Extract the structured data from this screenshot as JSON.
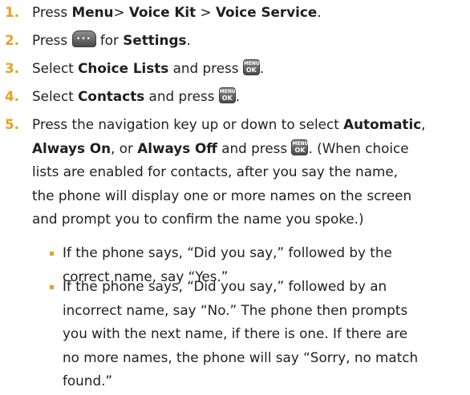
{
  "ok_icon": {
    "top": "MENU",
    "bottom": "OK"
  },
  "steps": [
    {
      "number": "1.",
      "a": "Press ",
      "b1": "Menu",
      "c": "> ",
      "b2": "Voice Kit",
      "d": " > ",
      "b3": "Voice Service",
      "e": "."
    },
    {
      "number": "2.",
      "a": "Press ",
      "b": " for ",
      "bold": "Settings",
      "c": "."
    },
    {
      "number": "3.",
      "a": "Select ",
      "bold": "Choice Lists",
      "b": " and press ",
      "c": "."
    },
    {
      "number": "4.",
      "a": "Select ",
      "bold": "Contacts",
      "b": " and press ",
      "c": "."
    },
    {
      "number": "5.",
      "l1a": "Press the navigation key up or down to select ",
      "l1b": "Automatic",
      "l1c": ",",
      "l2a": "Always On",
      "l2b": ", or ",
      "l2c": "Always Off",
      "l2d": " and press ",
      "l2e": ". (When choice",
      "l3": "lists are enabled for contacts, after you say the name,",
      "l4": "the phone will display one or more names on the screen",
      "l5": "and prompt you to confirm the name you spoke.)"
    }
  ],
  "bullets": [
    {
      "lines": [
        "If the phone says, “Did you say,” followed by the",
        "correct name, say “Yes.”"
      ]
    },
    {
      "lines": [
        "If the phone says, “Did you say,” followed by an",
        "incorrect name, say “No.” The phone then prompts",
        "you with the next name, if there is one. If there are",
        "no more names, the phone will say “Sorry, no match",
        "found.”"
      ]
    }
  ]
}
